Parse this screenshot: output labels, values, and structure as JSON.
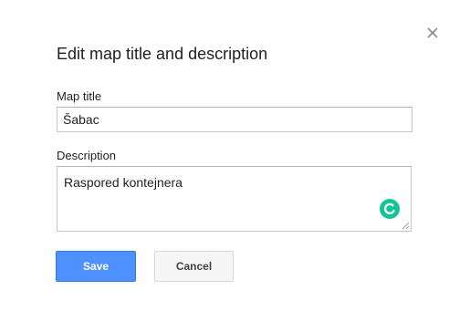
{
  "dialog": {
    "title": "Edit map title and description",
    "close_icon": "close-icon"
  },
  "map_title": {
    "label": "Map title",
    "value": "Šabac"
  },
  "description": {
    "label": "Description",
    "value": "Raspored kontejnera",
    "assistant_icon": "grammarly-icon"
  },
  "buttons": {
    "save_label": "Save",
    "cancel_label": "Cancel"
  },
  "colors": {
    "primary_button": "#4d90fe",
    "secondary_button": "#f5f5f5",
    "assistant_icon": "#15c39a"
  }
}
